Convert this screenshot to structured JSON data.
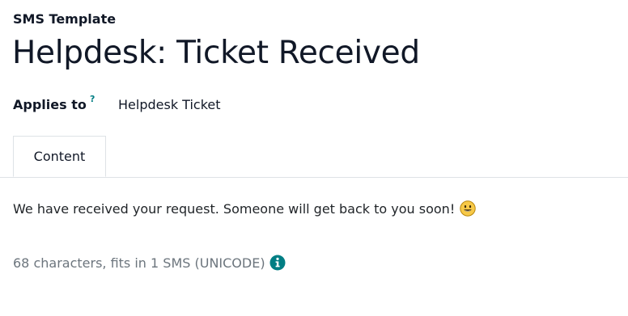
{
  "record": {
    "model_label": "SMS Template",
    "title": "Helpdesk: Ticket Received"
  },
  "fields": {
    "applies_to": {
      "label": "Applies to",
      "help_marker": "?",
      "value": "Helpdesk Ticket"
    }
  },
  "notebook": {
    "tabs": [
      {
        "label": "Content",
        "active": true
      }
    ]
  },
  "content": {
    "body": "We have received your request. Someone will get back to you soon!",
    "emoji_icon": "smiley-face-emoji",
    "counter_text": "68 characters, fits in 1 SMS (UNICODE)",
    "info_icon": "info-circle-icon"
  },
  "colors": {
    "accent": "#017e84",
    "emoji_yellow": "#f7c948",
    "muted_text": "#6c757d",
    "border": "#dee2e6"
  }
}
